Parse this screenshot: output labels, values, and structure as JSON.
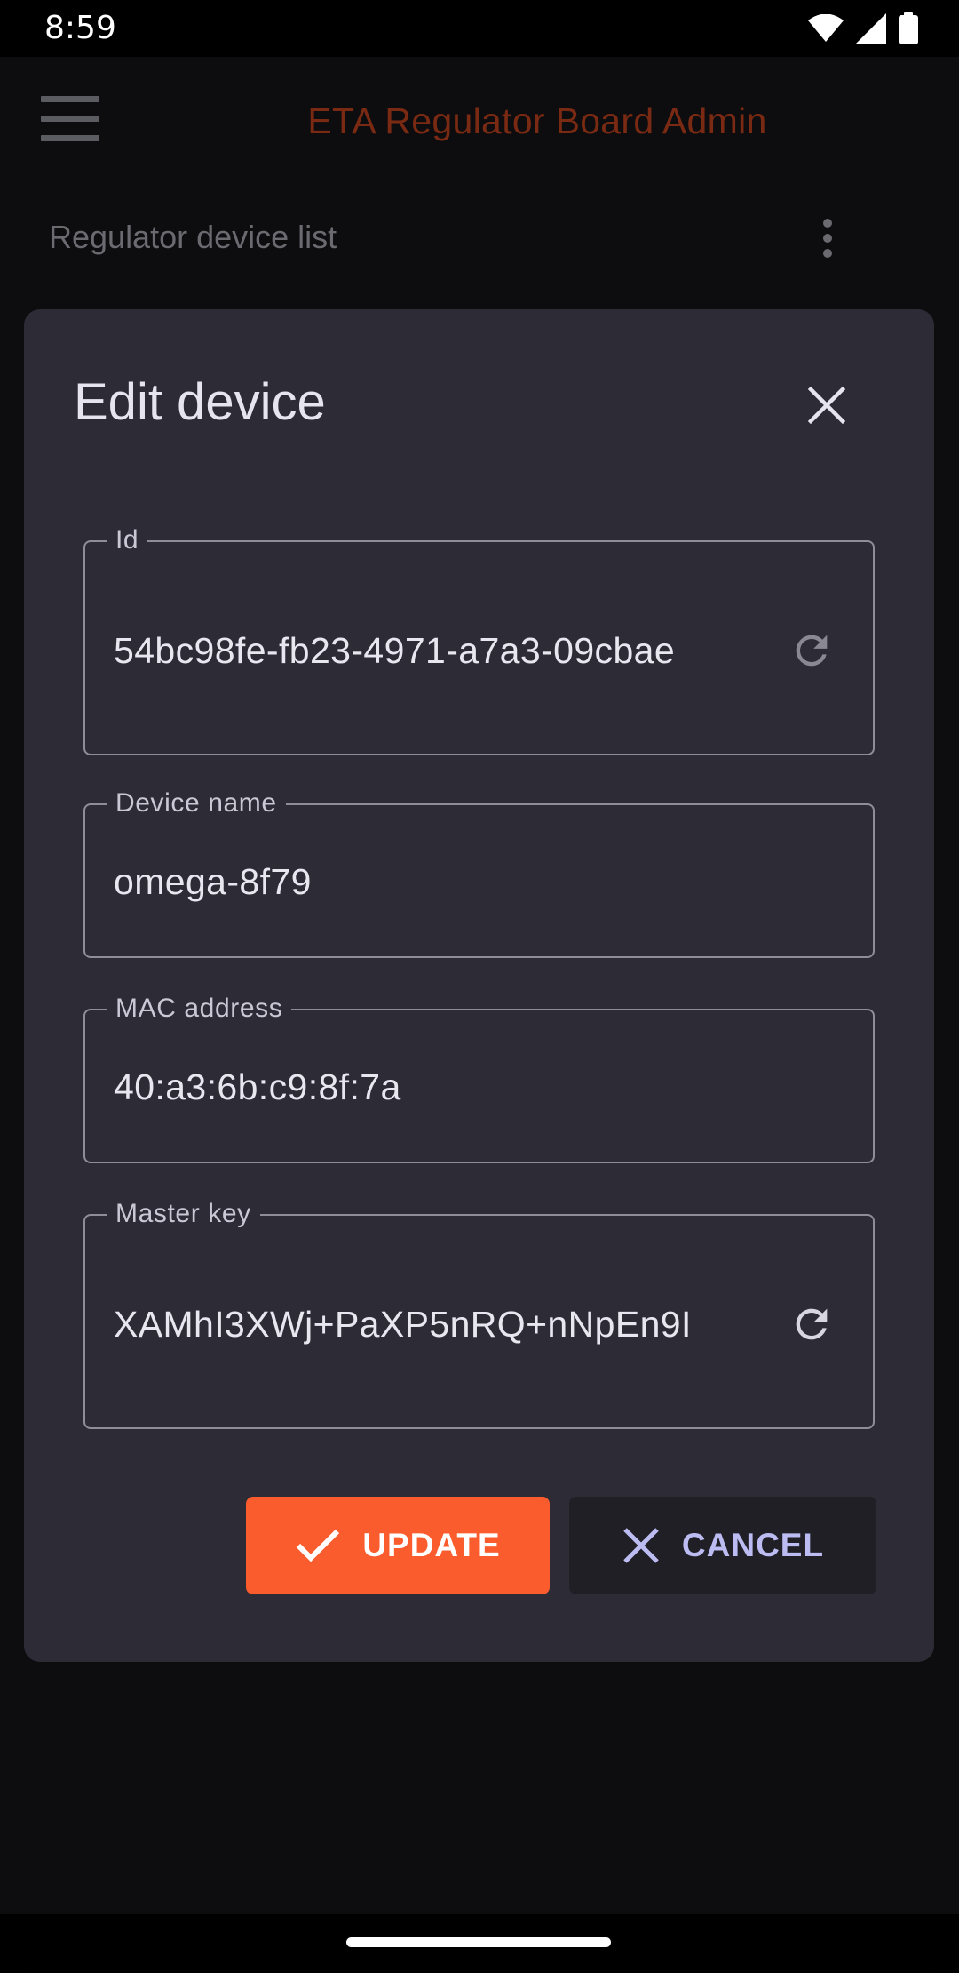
{
  "status_bar": {
    "time": "8:59",
    "icons": [
      "wifi-icon",
      "signal-icon",
      "battery-icon"
    ]
  },
  "app_bar": {
    "title": "ETA Regulator Board Admin",
    "menu_icon": "hamburger-menu-icon"
  },
  "sub_header": {
    "title": "Regulator device list",
    "overflow_icon": "more-vert-icon"
  },
  "dialog": {
    "title": "Edit device",
    "close_icon": "close-icon",
    "fields": {
      "id": {
        "label": "Id",
        "value": "54bc98fe-fb23-4971-a7a3-09cbae",
        "action_icon": "refresh-icon"
      },
      "device_name": {
        "label": "Device name",
        "value": "omega-8f79"
      },
      "mac_address": {
        "label": "MAC address",
        "value": "40:a3:6b:c9:8f:7a"
      },
      "master_key": {
        "label": "Master key",
        "value": "XAMhI3XWj+PaXP5nRQ+nNpEn9I",
        "action_icon": "refresh-icon"
      }
    },
    "buttons": {
      "update": {
        "label": "UPDATE",
        "icon": "check-icon"
      },
      "cancel": {
        "label": "CANCEL",
        "icon": "close-icon"
      }
    }
  },
  "colors": {
    "accent": "#fa5c2e",
    "app_title": "#7a2a12",
    "dialog_bg": "#2c2b36",
    "cancel_text": "#bcbcf3"
  }
}
